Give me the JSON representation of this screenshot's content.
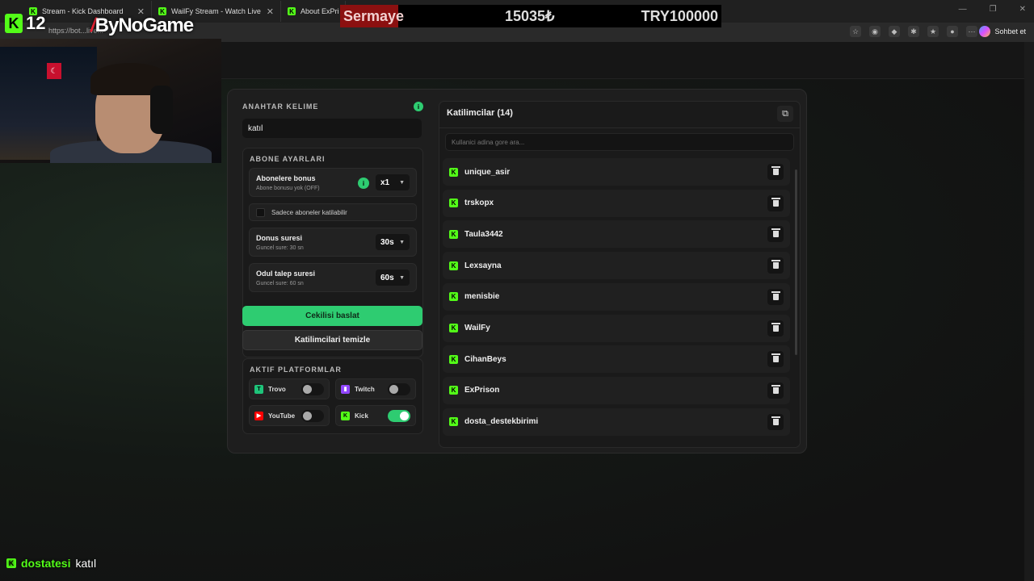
{
  "browser": {
    "tabs": [
      {
        "title": "Stream - Kick Dashboard"
      },
      {
        "title": "WailFy Stream - Watch Live on Kick"
      },
      {
        "title": "About ExPrison"
      }
    ],
    "url": "https://bot...live...",
    "copilot_label": "Sohbet et"
  },
  "overlay": {
    "viewer_count": "12",
    "brand": "ByNoGame",
    "ticker": {
      "label": "Sermaye",
      "value1": "15035₺",
      "value2": "TRY100000"
    },
    "chat": {
      "user": "dostatesi",
      "message": "katıl"
    }
  },
  "keyword": {
    "title": "ANAHTAR KELIME",
    "value": "katıl"
  },
  "subscriber": {
    "title": "ABONE AYARLARI",
    "bonus_title": "Abonelere bonus",
    "bonus_sub": "Abone bonusu yok (OFF)",
    "bonus_value": "x1",
    "only_subs_label": "Sadece aboneler katilabilir",
    "duration_title": "Donus suresi",
    "duration_sub": "Guncel sure: 30 sn",
    "duration_value": "30s",
    "claim_title": "Odul talep suresi",
    "claim_sub": "Guncel sure: 60 sn",
    "claim_value": "60s"
  },
  "buttons": {
    "start": "Cekilisi baslat",
    "clear": "Katilimcilari temizle"
  },
  "platforms": {
    "title": "AKTIF PLATFORMLAR",
    "items": [
      {
        "name": "Trovo",
        "enabled": false,
        "color": "#1ec47a"
      },
      {
        "name": "Twitch",
        "enabled": false,
        "color": "#9146ff"
      },
      {
        "name": "YouTube",
        "enabled": false,
        "color": "#ff0000"
      },
      {
        "name": "Kick",
        "enabled": true,
        "color": "#53fc18"
      }
    ]
  },
  "participants": {
    "title": "Katilimcilar (14)",
    "search_placeholder": "Kullanici adina gore ara...",
    "list": [
      "unique_asir",
      "trskopx",
      "Taula3442",
      "Lexsayna",
      "menisbie",
      "WailFy",
      "CihanBeys",
      "ExPrison",
      "dosta_destekbirimi"
    ]
  },
  "colors": {
    "accent": "#2ecc71",
    "kick": "#53fc18"
  }
}
